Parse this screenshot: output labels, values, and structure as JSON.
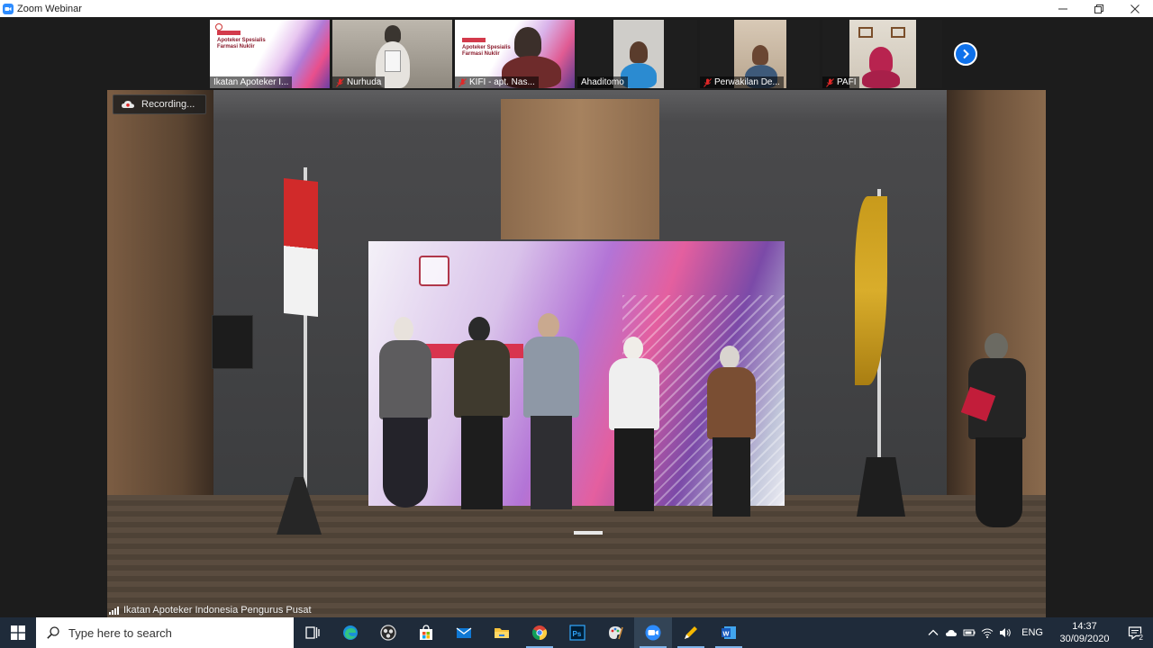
{
  "window": {
    "title": "Zoom Webinar"
  },
  "thumbnails": [
    {
      "label": "Ikatan Apoteker I...",
      "muted": false,
      "kind": "slide"
    },
    {
      "label": "Nurhuda",
      "muted": true,
      "kind": "person"
    },
    {
      "label": "KIFI - apt. Nas...",
      "muted": true,
      "kind": "slide-person"
    },
    {
      "label": "Ahaditomo",
      "muted": false,
      "kind": "person"
    },
    {
      "label": "Perwakilan De...",
      "muted": true,
      "kind": "person"
    },
    {
      "label": "PAFI",
      "muted": true,
      "kind": "person"
    }
  ],
  "slide": {
    "line1": "Apoteker Spesialis",
    "line2": "Farmasi Nuklir"
  },
  "recording": {
    "label": "Recording..."
  },
  "active_speaker": {
    "name": "Ikatan Apoteker Indonesia Pengurus Pusat"
  },
  "taskbar": {
    "search_placeholder": "Type here to search",
    "apps": [
      {
        "name": "task-view-icon",
        "open": false
      },
      {
        "name": "edge-icon",
        "open": false
      },
      {
        "name": "obs-icon",
        "open": false
      },
      {
        "name": "store-icon",
        "open": false
      },
      {
        "name": "mail-icon",
        "open": false
      },
      {
        "name": "file-explorer-icon",
        "open": false
      },
      {
        "name": "chrome-icon",
        "open": true
      },
      {
        "name": "photoshop-icon",
        "open": false
      },
      {
        "name": "paint-icon",
        "open": false
      },
      {
        "name": "zoom-icon",
        "open": true,
        "active": true
      },
      {
        "name": "pen-tool-icon",
        "open": true
      },
      {
        "name": "word-icon",
        "open": true
      }
    ],
    "language": "ENG",
    "time": "14:37",
    "date": "30/09/2020",
    "notification_count": "2"
  },
  "colors": {
    "zoom_blue": "#2d8cff",
    "next_button": "#0e71eb",
    "taskbar": "#1f2b3a",
    "mute_red": "#e02828"
  }
}
